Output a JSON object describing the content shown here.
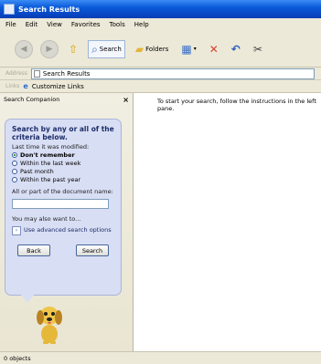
{
  "window": {
    "title": "Search Results"
  },
  "menu": [
    "File",
    "Edit",
    "View",
    "Favorites",
    "Tools",
    "Help"
  ],
  "toolbar": {
    "search_label": "Search",
    "folders_label": "Folders",
    "icons": [
      "back-icon",
      "forward-icon",
      "up-folder-icon",
      "search-icon",
      "folders-icon",
      "views-icon",
      "delete-icon",
      "undo-icon",
      "cut-icon"
    ]
  },
  "address": {
    "label": "Address",
    "value": "Search Results"
  },
  "links": {
    "label": "Links",
    "item": "Customize Links"
  },
  "sidebar": {
    "title": "Search Companion",
    "close": "×",
    "heading": "Search by any or all of the criteria below.",
    "modified_label": "Last time it was modified:",
    "options": [
      {
        "label": "Don't remember",
        "selected": true
      },
      {
        "label": "Within the last week",
        "selected": false
      },
      {
        "label": "Past month",
        "selected": false
      },
      {
        "label": "Within the past year",
        "selected": false
      }
    ],
    "name_label": "All or part of the document name:",
    "name_value": "",
    "also_label": "You may also want to...",
    "advanced_label": "Use advanced search options",
    "back_button": "Back",
    "search_button": "Search"
  },
  "main": {
    "message": "To start your search, follow the instructions in the left pane."
  },
  "status": {
    "text": "0 objects"
  },
  "colors": {
    "title_bar": "#0a5bd9",
    "panel": "#d8def4",
    "chrome": "#ece9d8"
  }
}
